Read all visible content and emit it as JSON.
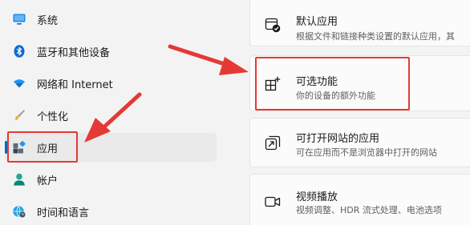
{
  "sidebar": {
    "items": [
      {
        "label": "系统",
        "icon": "monitor-icon"
      },
      {
        "label": "蓝牙和其他设备",
        "icon": "bluetooth-icon"
      },
      {
        "label": "网络和 Internet",
        "icon": "wifi-icon"
      },
      {
        "label": "个性化",
        "icon": "brush-icon"
      },
      {
        "label": "应用",
        "icon": "apps-icon",
        "selected": true
      },
      {
        "label": "帐户",
        "icon": "person-icon"
      },
      {
        "label": "时间和语言",
        "icon": "globe-clock-icon"
      }
    ]
  },
  "main": {
    "cards": [
      {
        "title": "默认应用",
        "desc": "根据文件和链接种类设置的默认应用，其",
        "icon": "default-apps-icon"
      },
      {
        "title": "可选功能",
        "desc": "你的设备的额外功能",
        "icon": "optional-features-icon"
      },
      {
        "title": "可打开网站的应用",
        "desc": "可在应用而不是浏览器中打开的网站",
        "icon": "apps-for-websites-icon"
      },
      {
        "title": "视频播放",
        "desc": "视频调整、HDR 流式处理、电池选项",
        "icon": "video-playback-icon"
      }
    ]
  },
  "colors": {
    "accent": "#0067c0",
    "annotation_red": "#e53935"
  }
}
